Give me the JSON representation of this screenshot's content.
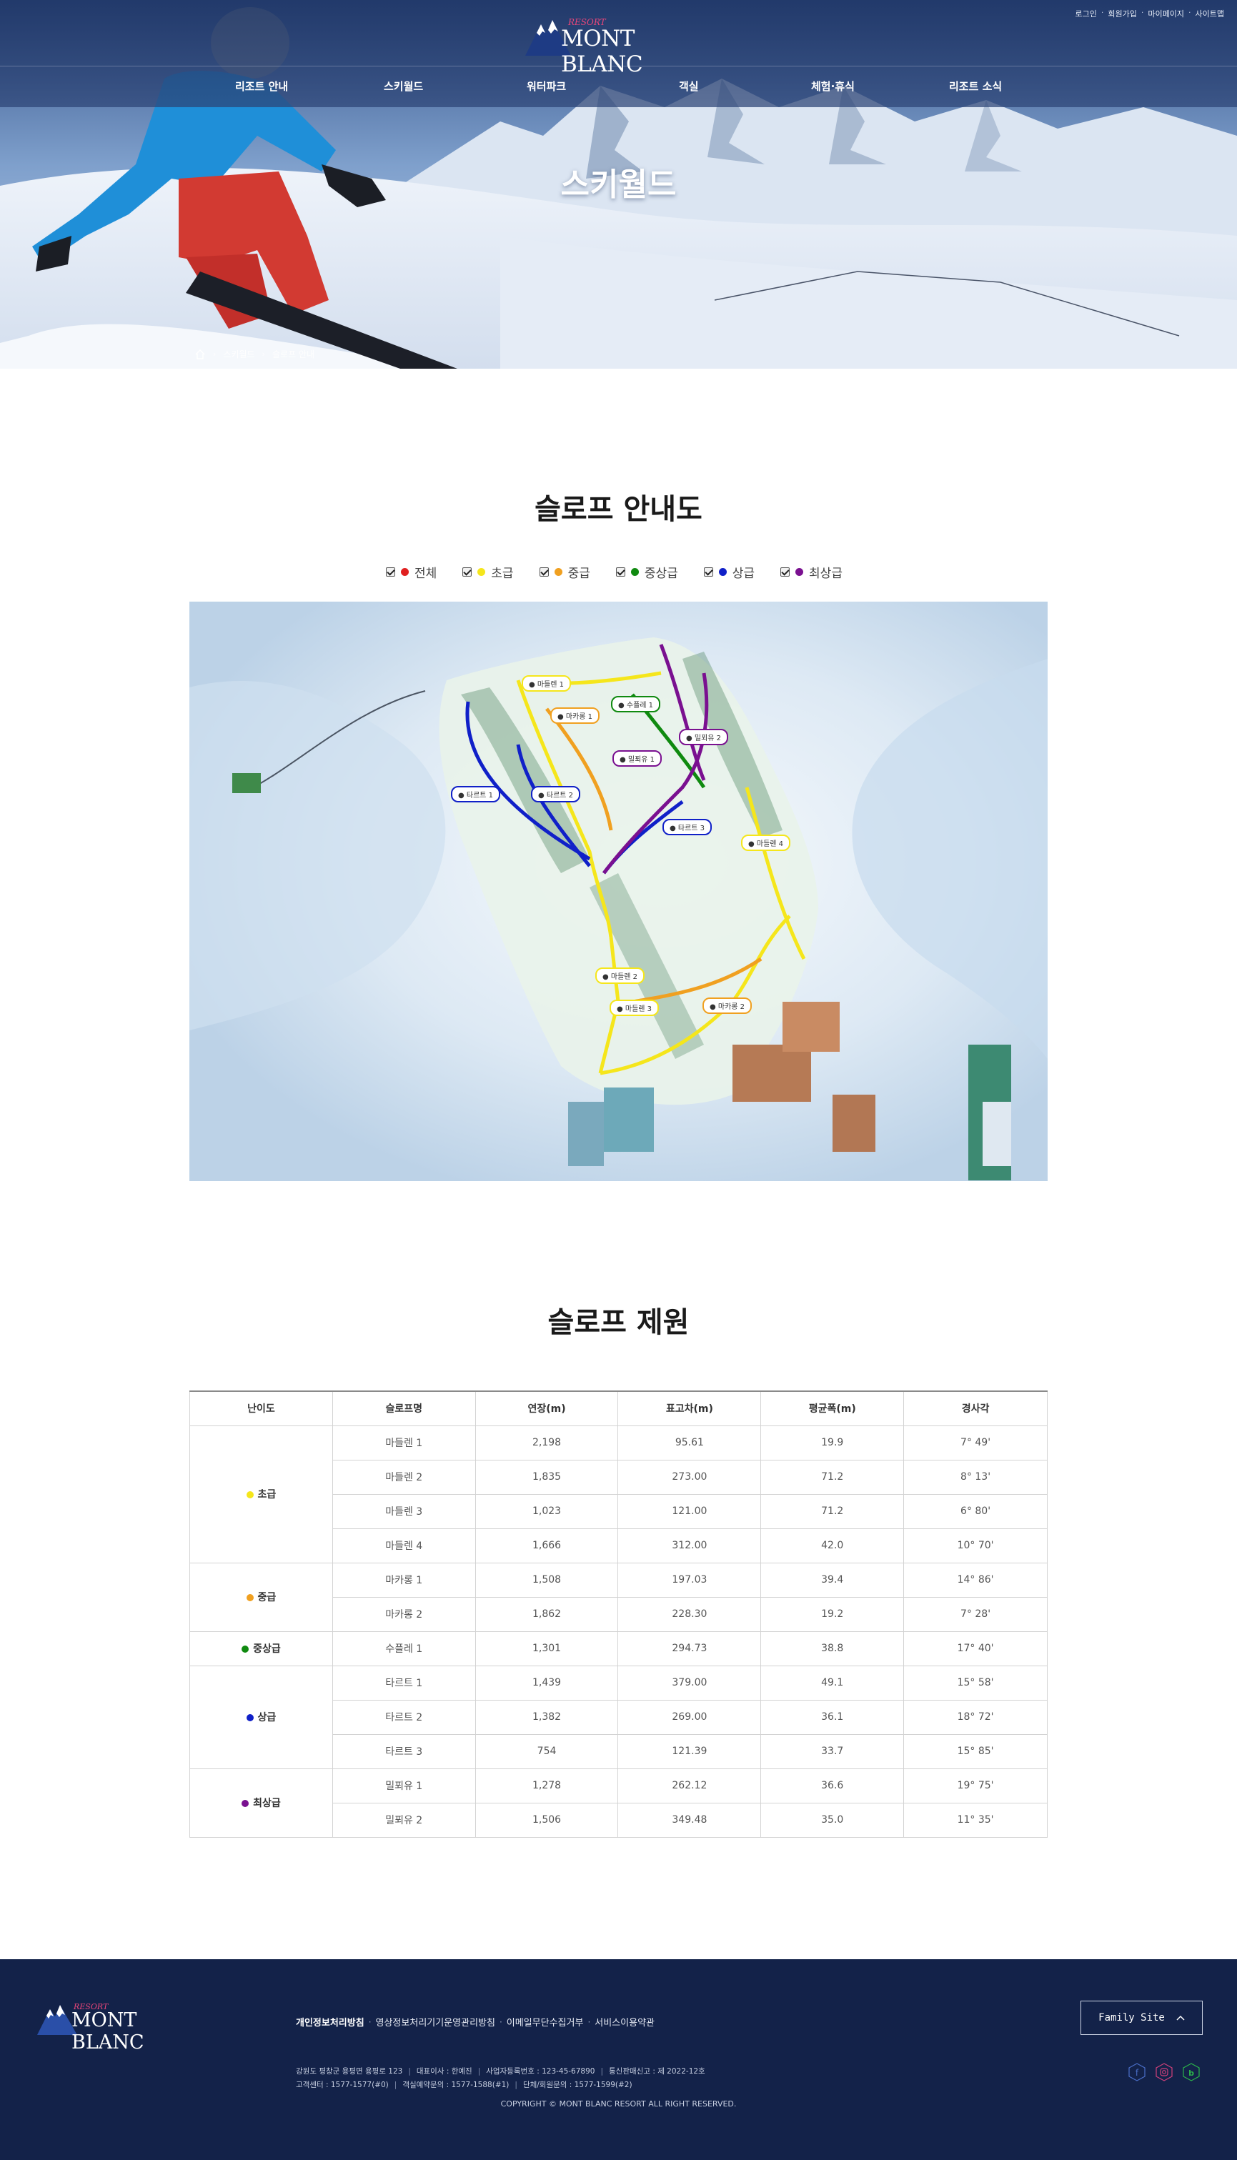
{
  "header": {
    "logo_resort": "RESORT",
    "logo_brand": "MONT BLANC",
    "util": [
      "로그인",
      "회원가입",
      "마이페이지",
      "사이트맵"
    ],
    "nav": [
      "리조트 안내",
      "스키월드",
      "워터파크",
      "객실",
      "체험·휴식",
      "리조트 소식"
    ]
  },
  "hero": {
    "title": "스키월드",
    "breadcrumb": [
      "스키월드",
      "슬로프 안내"
    ]
  },
  "slope_map": {
    "title": "슬로프 안내도",
    "filters": [
      {
        "label": "전체",
        "color": "#e02020"
      },
      {
        "label": "초급",
        "color": "#f5e61b"
      },
      {
        "label": "중급",
        "color": "#f0a020"
      },
      {
        "label": "중상급",
        "color": "#108a10"
      },
      {
        "label": "상급",
        "color": "#1020c8"
      },
      {
        "label": "최상급",
        "color": "#7a1090"
      }
    ],
    "pins": [
      "마들렌 1",
      "마카롱 1",
      "수플레 1",
      "밀푀유 1",
      "밀푀유 2",
      "타르트 1",
      "타르트 2",
      "타르트 3",
      "마들렌 4",
      "마들렌 2",
      "마들렌 3",
      "마카롱 2"
    ]
  },
  "spec": {
    "title": "슬로프 제원",
    "headers": [
      "난이도",
      "슬로프명",
      "연장(m)",
      "표고차(m)",
      "평균폭(m)",
      "경사각"
    ],
    "groups": [
      {
        "level": "초급",
        "color": "#f5e61b",
        "rows": [
          [
            "마들렌 1",
            "2,198",
            "95.61",
            "19.9",
            "7° 49'"
          ],
          [
            "마들렌 2",
            "1,835",
            "273.00",
            "71.2",
            "8° 13'"
          ],
          [
            "마들렌 3",
            "1,023",
            "121.00",
            "71.2",
            "6° 80'"
          ],
          [
            "마들렌 4",
            "1,666",
            "312.00",
            "42.0",
            "10° 70'"
          ]
        ]
      },
      {
        "level": "중급",
        "color": "#f0a020",
        "rows": [
          [
            "마카롱 1",
            "1,508",
            "197.03",
            "39.4",
            "14° 86'"
          ],
          [
            "마카롱 2",
            "1,862",
            "228.30",
            "19.2",
            "7° 28'"
          ]
        ]
      },
      {
        "level": "중상급",
        "color": "#108a10",
        "rows": [
          [
            "수플레 1",
            "1,301",
            "294.73",
            "38.8",
            "17° 40'"
          ]
        ]
      },
      {
        "level": "상급",
        "color": "#1020c8",
        "rows": [
          [
            "타르트 1",
            "1,439",
            "379.00",
            "49.1",
            "15° 58'"
          ],
          [
            "타르트 2",
            "1,382",
            "269.00",
            "36.1",
            "18° 72'"
          ],
          [
            "타르트 3",
            "754",
            "121.39",
            "33.7",
            "15° 85'"
          ]
        ]
      },
      {
        "level": "최상급",
        "color": "#7a1090",
        "rows": [
          [
            "밀푀유 1",
            "1,278",
            "262.12",
            "36.6",
            "19° 75'"
          ],
          [
            "밀푀유 2",
            "1,506",
            "349.48",
            "35.0",
            "11° 35'"
          ]
        ]
      }
    ]
  },
  "footer": {
    "logo_resort": "RESORT",
    "logo_brand": "MONT BLANC",
    "links": [
      "개인정보처리방침",
      "영상정보처리기기운영관리방침",
      "이메일무단수집거부",
      "서비스이용약관"
    ],
    "address": "강원도 평창군 용평면 용평로 123",
    "ceo": "대표이사 : 한예진",
    "biz_no": "사업자등록번호 : 123-45-67890",
    "mail_order": "통신판매신고 : 제 2022-12호",
    "cs": "고객센터 : 1577-1577(#0)",
    "room": "객실예약문의 : 1577-1588(#1)",
    "group": "단체/회원문의 : 1577-1599(#2)",
    "copyright": "COPYRIGHT © MONT BLANC RESORT ALL RIGHT RESERVED.",
    "family_site": "Family Site",
    "sns": [
      "facebook-icon",
      "instagram-icon",
      "blog-icon"
    ]
  }
}
